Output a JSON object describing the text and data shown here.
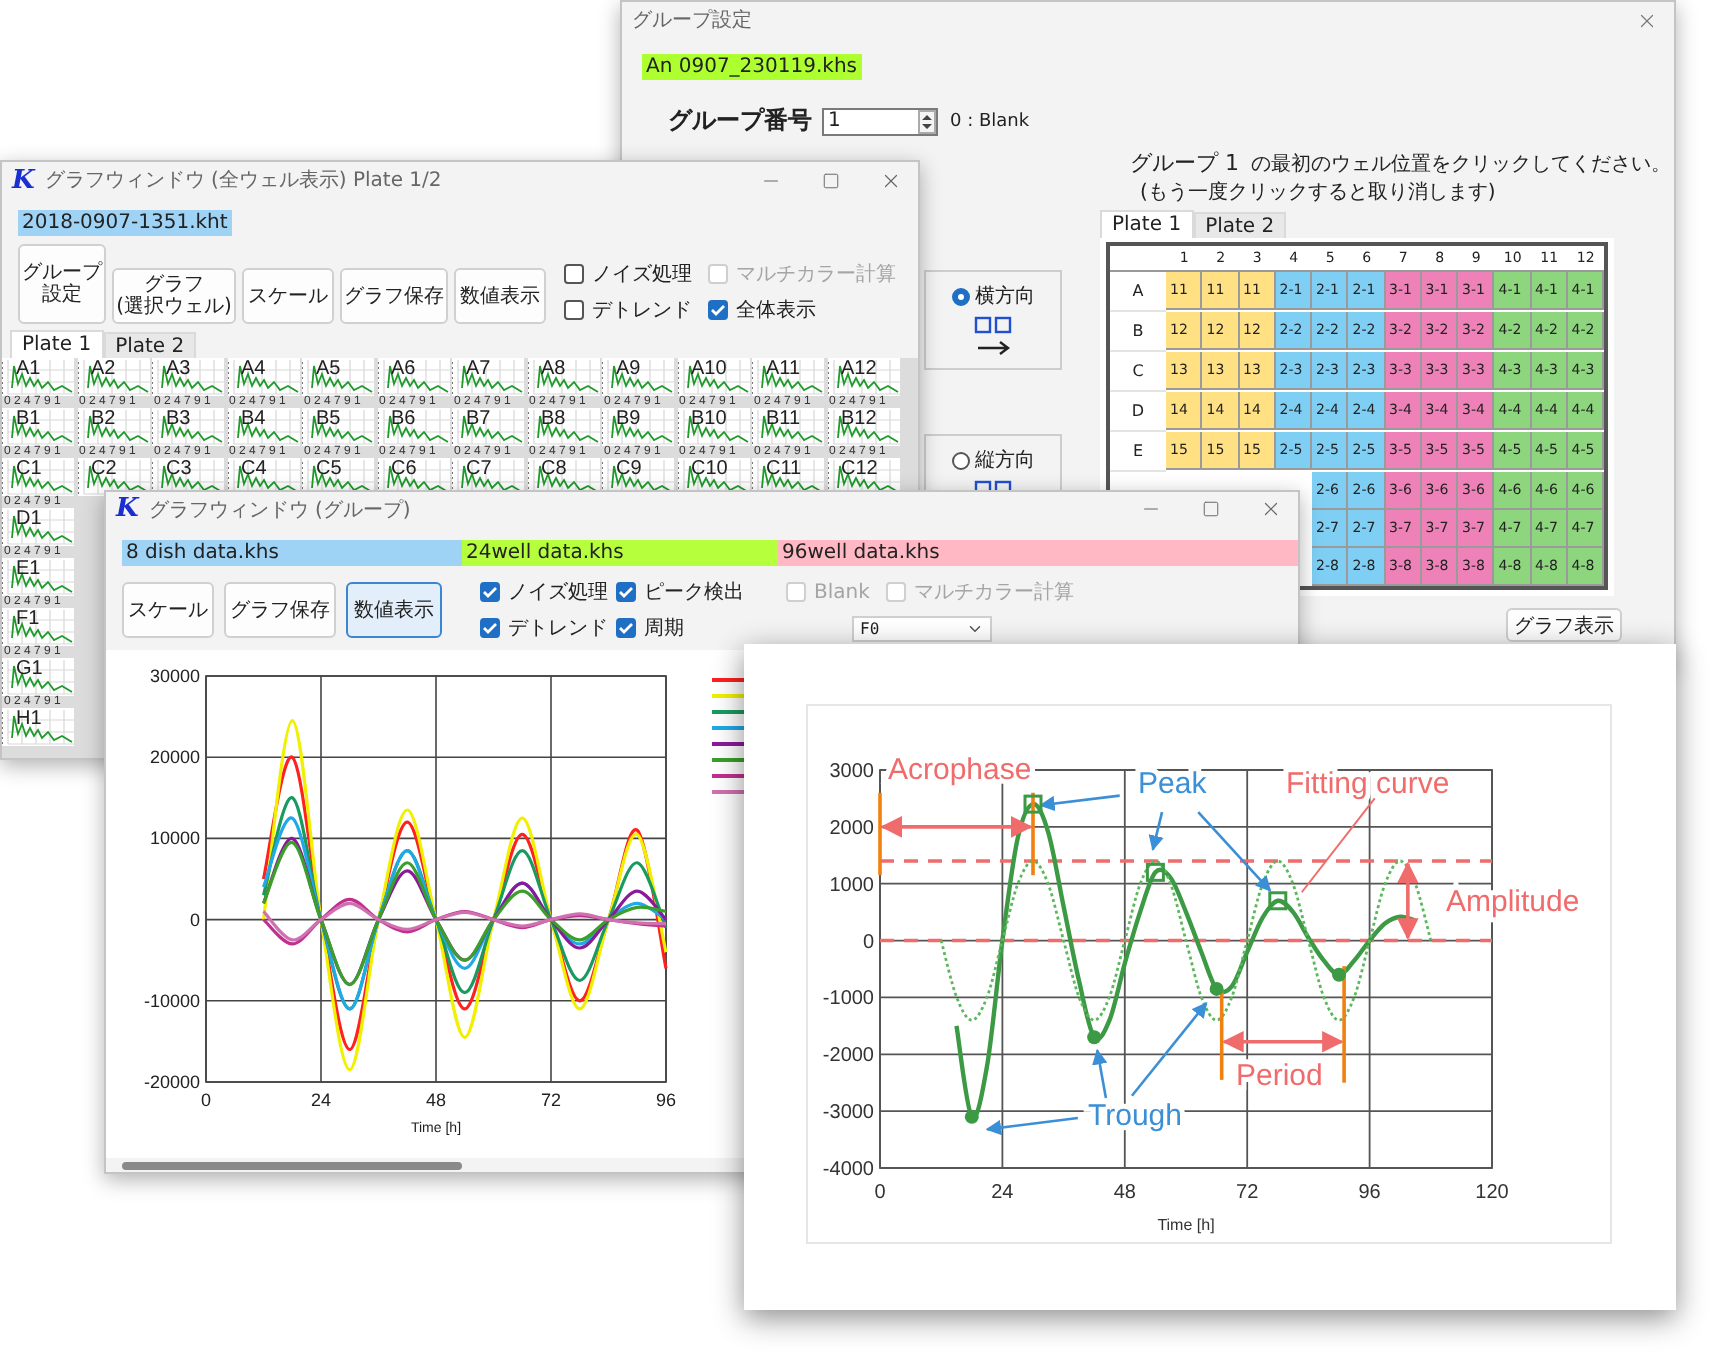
{
  "group_settings_window": {
    "title": "グループ設定",
    "file_label": {
      "text": "An 0907_230119.khs",
      "color": "#adff2f"
    },
    "group_number": {
      "label": "グループ番号",
      "value": "1",
      "hint": "0 : Blank"
    },
    "instruction": {
      "group": "グループ 1",
      "text": "の最初のウェル位置をクリックしてください。",
      "note": "(もう一度クリックすると取り消します)"
    },
    "direction_options": [
      {
        "label": "横方向",
        "selected": true
      },
      {
        "label": "縦方向",
        "selected": false
      }
    ],
    "tabs": [
      {
        "label": "Plate 1",
        "selected": true
      },
      {
        "label": "Plate 2",
        "selected": false
      }
    ],
    "plate": {
      "columns": [
        "1",
        "2",
        "3",
        "4",
        "5",
        "6",
        "7",
        "8",
        "9",
        "10",
        "11",
        "12"
      ],
      "rows": [
        {
          "label": "A",
          "cells": [
            {
              "text": "11",
              "color": "#ffe083"
            },
            {
              "text": "11",
              "color": "#ffe083"
            },
            {
              "text": "11",
              "color": "#ffe083"
            },
            {
              "text": "2-1",
              "color": "#7fcff5"
            },
            {
              "text": "2-1",
              "color": "#7fcff5"
            },
            {
              "text": "2-1",
              "color": "#7fcff5"
            },
            {
              "text": "3-1",
              "color": "#ee82b8"
            },
            {
              "text": "3-1",
              "color": "#ee82b8"
            },
            {
              "text": "3-1",
              "color": "#ee82b8"
            },
            {
              "text": "4-1",
              "color": "#8ed67e"
            },
            {
              "text": "4-1",
              "color": "#8ed67e"
            },
            {
              "text": "4-1",
              "color": "#8ed67e"
            }
          ]
        },
        {
          "label": "B",
          "cells": [
            {
              "text": "12",
              "color": "#ffe083"
            },
            {
              "text": "12",
              "color": "#ffe083"
            },
            {
              "text": "12",
              "color": "#ffe083"
            },
            {
              "text": "2-2",
              "color": "#7fcff5"
            },
            {
              "text": "2-2",
              "color": "#7fcff5"
            },
            {
              "text": "2-2",
              "color": "#7fcff5"
            },
            {
              "text": "3-2",
              "color": "#ee82b8"
            },
            {
              "text": "3-2",
              "color": "#ee82b8"
            },
            {
              "text": "3-2",
              "color": "#ee82b8"
            },
            {
              "text": "4-2",
              "color": "#8ed67e"
            },
            {
              "text": "4-2",
              "color": "#8ed67e"
            },
            {
              "text": "4-2",
              "color": "#8ed67e"
            }
          ]
        },
        {
          "label": "C",
          "cells": [
            {
              "text": "13",
              "color": "#ffe083"
            },
            {
              "text": "13",
              "color": "#ffe083"
            },
            {
              "text": "13",
              "color": "#ffe083"
            },
            {
              "text": "2-3",
              "color": "#7fcff5"
            },
            {
              "text": "2-3",
              "color": "#7fcff5"
            },
            {
              "text": "2-3",
              "color": "#7fcff5"
            },
            {
              "text": "3-3",
              "color": "#ee82b8"
            },
            {
              "text": "3-3",
              "color": "#ee82b8"
            },
            {
              "text": "3-3",
              "color": "#ee82b8"
            },
            {
              "text": "4-3",
              "color": "#8ed67e"
            },
            {
              "text": "4-3",
              "color": "#8ed67e"
            },
            {
              "text": "4-3",
              "color": "#8ed67e"
            }
          ]
        },
        {
          "label": "D",
          "cells": [
            {
              "text": "14",
              "color": "#ffe083"
            },
            {
              "text": "14",
              "color": "#ffe083"
            },
            {
              "text": "14",
              "color": "#ffe083"
            },
            {
              "text": "2-4",
              "color": "#7fcff5"
            },
            {
              "text": "2-4",
              "color": "#7fcff5"
            },
            {
              "text": "2-4",
              "color": "#7fcff5"
            },
            {
              "text": "3-4",
              "color": "#ee82b8"
            },
            {
              "text": "3-4",
              "color": "#ee82b8"
            },
            {
              "text": "3-4",
              "color": "#ee82b8"
            },
            {
              "text": "4-4",
              "color": "#8ed67e"
            },
            {
              "text": "4-4",
              "color": "#8ed67e"
            },
            {
              "text": "4-4",
              "color": "#8ed67e"
            }
          ]
        },
        {
          "label": "E",
          "cells": [
            {
              "text": "15",
              "color": "#ffe083"
            },
            {
              "text": "15",
              "color": "#ffe083"
            },
            {
              "text": "15",
              "color": "#ffe083"
            },
            {
              "text": "2-5",
              "color": "#7fcff5"
            },
            {
              "text": "2-5",
              "color": "#7fcff5"
            },
            {
              "text": "2-5",
              "color": "#7fcff5"
            },
            {
              "text": "3-5",
              "color": "#ee82b8"
            },
            {
              "text": "3-5",
              "color": "#ee82b8"
            },
            {
              "text": "3-5",
              "color": "#ee82b8"
            },
            {
              "text": "4-5",
              "color": "#8ed67e"
            },
            {
              "text": "4-5",
              "color": "#8ed67e"
            },
            {
              "text": "4-5",
              "color": "#8ed67e"
            }
          ]
        },
        {
          "cells": [
            {
              "text": "2-6",
              "color": "#7fcff5"
            },
            {
              "text": "2-6",
              "color": "#7fcff5"
            },
            {
              "text": "3-6",
              "color": "#ee82b8"
            },
            {
              "text": "3-6",
              "color": "#ee82b8"
            },
            {
              "text": "3-6",
              "color": "#ee82b8"
            },
            {
              "text": "4-6",
              "color": "#8ed67e"
            },
            {
              "text": "4-6",
              "color": "#8ed67e"
            },
            {
              "text": "4-6",
              "color": "#8ed67e"
            }
          ]
        },
        {
          "cells": [
            {
              "text": "2-7",
              "color": "#7fcff5"
            },
            {
              "text": "2-7",
              "color": "#7fcff5"
            },
            {
              "text": "3-7",
              "color": "#ee82b8"
            },
            {
              "text": "3-7",
              "color": "#ee82b8"
            },
            {
              "text": "3-7",
              "color": "#ee82b8"
            },
            {
              "text": "4-7",
              "color": "#8ed67e"
            },
            {
              "text": "4-7",
              "color": "#8ed67e"
            },
            {
              "text": "4-7",
              "color": "#8ed67e"
            }
          ]
        },
        {
          "cells": [
            {
              "text": "2-8",
              "color": "#7fcff5"
            },
            {
              "text": "2-8",
              "color": "#7fcff5"
            },
            {
              "text": "3-8",
              "color": "#ee82b8"
            },
            {
              "text": "3-8",
              "color": "#ee82b8"
            },
            {
              "text": "3-8",
              "color": "#ee82b8"
            },
            {
              "text": "4-8",
              "color": "#8ed67e"
            },
            {
              "text": "4-8",
              "color": "#8ed67e"
            },
            {
              "text": "4-8",
              "color": "#8ed67e"
            }
          ]
        }
      ]
    },
    "show_graph_button": "グラフ表示"
  },
  "all_wells_window": {
    "logo": "K",
    "title": "グラフウィンドウ (全ウェル表示) Plate 1/2",
    "file_label": {
      "text": "2018-0907-1351.kht",
      "color": "#9fd3f5"
    },
    "buttons": [
      {
        "lines": [
          "グループ",
          "設定"
        ]
      },
      {
        "lines": [
          "グラフ",
          "(選択ウェル)"
        ]
      },
      {
        "lines": [
          "スケール"
        ]
      },
      {
        "lines": [
          "グラフ保存"
        ]
      },
      {
        "lines": [
          "数値表示"
        ]
      }
    ],
    "options": [
      {
        "label": "ノイズ処理",
        "checked": false,
        "disabled": false
      },
      {
        "label": "マルチカラー計算",
        "checked": false,
        "disabled": true
      },
      {
        "label": "デトレンド",
        "checked": false,
        "disabled": false
      },
      {
        "label": "全体表示",
        "checked": true,
        "disabled": false
      }
    ],
    "tabs": [
      {
        "label": "Plate 1",
        "selected": true
      },
      {
        "label": "Plate 2",
        "selected": false
      }
    ],
    "well_rows": [
      {
        "wells": [
          {
            "label": "A1",
            "ticks": "0 2 4 7 9 1"
          },
          {
            "label": "A2",
            "ticks": "0 2 4 7 9 1"
          },
          {
            "label": "A3",
            "ticks": "0 2 4 7 9 1"
          },
          {
            "label": "A4",
            "ticks": "0 2 4 7 9 1"
          },
          {
            "label": "A5",
            "ticks": "0 2 4 7 9 1"
          },
          {
            "label": "A6",
            "ticks": "0 2 4 7 9 1"
          },
          {
            "label": "A7",
            "ticks": "0 2 4 7 9 1"
          },
          {
            "label": "A8",
            "ticks": "0 2 4 7 9 1"
          },
          {
            "label": "A9",
            "ticks": "0 2 4 7 9 1"
          },
          {
            "label": "A10",
            "ticks": "0 2 4 7 9 1"
          },
          {
            "label": "A11",
            "ticks": "0 2 4 7 9 1"
          },
          {
            "label": "A12",
            "ticks": "0 2 4 7 9 1"
          }
        ]
      },
      {
        "wells": [
          {
            "label": "B1",
            "ticks": "0 2 4 7 9 1"
          },
          {
            "label": "B2",
            "ticks": "0 2 4 7 9 1"
          },
          {
            "label": "B3",
            "ticks": "0 2 4 7 9 1"
          },
          {
            "label": "B4",
            "ticks": "0 2 4 7 9 1"
          },
          {
            "label": "B5",
            "ticks": "0 2 4 7 9 1"
          },
          {
            "label": "B6",
            "ticks": "0 2 4 7 9 1"
          },
          {
            "label": "B7",
            "ticks": "0 2 4 7 9 1"
          },
          {
            "label": "B8",
            "ticks": "0 2 4 7 9 1"
          },
          {
            "label": "B9",
            "ticks": "0 2 4 7 9 1"
          },
          {
            "label": "B10",
            "ticks": "0 2 4 7 9 1"
          },
          {
            "label": "B11",
            "ticks": "0 2 4 7 9 1"
          },
          {
            "label": "B12",
            "ticks": "0 2 4 7 9 1"
          }
        ]
      },
      {
        "wells": [
          {
            "label": "C1",
            "ticks": "0 2 4 7 9 1"
          },
          {
            "label": "C2"
          },
          {
            "label": "C3"
          },
          {
            "label": "C4"
          },
          {
            "label": "C5"
          },
          {
            "label": "C6"
          },
          {
            "label": "C7"
          },
          {
            "label": "C8"
          },
          {
            "label": "C9"
          },
          {
            "label": "C10"
          },
          {
            "label": "C11"
          },
          {
            "label": "C12"
          }
        ]
      },
      {
        "wells": [
          {
            "label": "D1",
            "ticks": "0 2 4 7 9 1"
          }
        ]
      },
      {
        "wells": [
          {
            "label": "E1",
            "ticks": "0 2 4 7 9 1"
          }
        ]
      },
      {
        "wells": [
          {
            "label": "F1",
            "ticks": "0 2 4 7 9 1"
          }
        ]
      },
      {
        "wells": [
          {
            "label": "G1",
            "ticks": "0 2 4 7 9 1"
          }
        ]
      },
      {
        "wells": [
          {
            "label": "H1"
          }
        ]
      }
    ]
  },
  "group_window": {
    "logo": "K",
    "title": "グラフウィンドウ (グループ)",
    "files": [
      {
        "label": "8 dish data.khs",
        "color": "#9fd3f5"
      },
      {
        "label": "24well data.khs",
        "color": "#b6ff3c"
      },
      {
        "label": "96well data.khs",
        "color": "#ffb8c4"
      }
    ],
    "buttons": [
      {
        "label": "スケール",
        "selected": false
      },
      {
        "label": "グラフ保存",
        "selected": false
      },
      {
        "label": "数値表示",
        "selected": true
      }
    ],
    "options": [
      {
        "label": "ノイズ処理",
        "checked": true,
        "disabled": false
      },
      {
        "label": "ピーク検出",
        "checked": true,
        "disabled": false
      },
      {
        "label": "デトレンド",
        "checked": true,
        "disabled": false
      },
      {
        "label": "周期",
        "checked": true,
        "disabled": false
      }
    ],
    "extra_options": [
      {
        "label": "Blank",
        "checked": false,
        "disabled": true
      },
      {
        "label": "マルチカラー計算",
        "checked": false,
        "disabled": true
      }
    ],
    "dropdown": {
      "value": "F0"
    },
    "chart_data": {
      "type": "line",
      "xlabel": "Time [h]",
      "x": [
        12,
        18,
        24,
        30,
        36,
        42,
        48,
        54,
        60,
        66,
        72,
        78,
        84,
        90,
        96
      ],
      "series": [
        {
          "color": "#ff2020",
          "values": [
            5000,
            20000,
            0,
            -16000,
            0,
            12000,
            0,
            -11000,
            0,
            10500,
            0,
            -10000,
            0,
            11000,
            -6000
          ]
        },
        {
          "color": "#f0f000",
          "values": [
            0,
            24500,
            0,
            -18500,
            0,
            13500,
            0,
            -14500,
            0,
            12500,
            0,
            -11000,
            0,
            10500,
            -4000
          ]
        },
        {
          "color": "#1a9a60",
          "values": [
            3000,
            15000,
            0,
            -11000,
            0,
            8500,
            0,
            -9000,
            0,
            8500,
            0,
            -7500,
            0,
            7000,
            -1000
          ]
        },
        {
          "color": "#20a8e8",
          "values": [
            4000,
            12500,
            0,
            -11000,
            0,
            8500,
            0,
            -6000,
            0,
            4500,
            0,
            -3000,
            0,
            2000,
            0
          ]
        },
        {
          "color": "#8a1a9a",
          "values": [
            2000,
            10000,
            0,
            -8000,
            0,
            6000,
            0,
            -5000,
            0,
            4500,
            0,
            -3500,
            0,
            3500,
            0
          ]
        },
        {
          "color": "#3aa02a",
          "values": [
            2000,
            9500,
            0,
            -8000,
            0,
            7000,
            0,
            -5000,
            0,
            3500,
            0,
            -2500,
            0,
            1500,
            1000
          ]
        },
        {
          "color": "#c0308f",
          "values": [
            0,
            -3000,
            0,
            2500,
            0,
            -1500,
            0,
            1000,
            0,
            -1000,
            0,
            500,
            0,
            -500,
            -800
          ]
        },
        {
          "color": "#d070b0",
          "values": [
            1000,
            -2500,
            0,
            2000,
            0,
            -1200,
            0,
            900,
            0,
            -800,
            0,
            700,
            0,
            -400,
            -500
          ]
        }
      ],
      "xlim": [
        0,
        96
      ],
      "ylim": [
        -20000,
        30000
      ],
      "xticks": [
        0,
        24,
        48,
        72,
        96
      ],
      "yticks": [
        -20000,
        -10000,
        0,
        10000,
        20000,
        30000
      ],
      "grid": true
    }
  },
  "annotated_figure": {
    "chart_data": {
      "type": "line",
      "xlabel": "Time [h]",
      "x": [
        12,
        15,
        18,
        21,
        24,
        27,
        30,
        33,
        36,
        39,
        42,
        45,
        48,
        51,
        54,
        57,
        60,
        63,
        66,
        69,
        72,
        75,
        78,
        81,
        84,
        87,
        90,
        93,
        96,
        99,
        102,
        105,
        108
      ],
      "series": [
        {
          "color": "#3c9a45",
          "values": [
            null,
            -1500,
            -3100,
            -2200,
            0,
            1800,
            2400,
            1900,
            600,
            -700,
            -1700,
            -1400,
            -400,
            500,
            1200,
            1100,
            500,
            -200,
            -850,
            -800,
            -200,
            400,
            700,
            500,
            50,
            -350,
            -600,
            -350,
            0,
            300,
            420,
            350,
            null
          ]
        },
        {
          "color": "#5cb85c",
          "line_style": "dotted",
          "values": [
            0,
            -990,
            -1400,
            -990,
            0,
            990,
            1400,
            990,
            0,
            -990,
            -1400,
            -990,
            0,
            990,
            1400,
            990,
            0,
            -990,
            -1400,
            -990,
            0,
            990,
            1400,
            990,
            0,
            -990,
            -1400,
            -990,
            0,
            990,
            1400,
            990,
            0
          ]
        }
      ],
      "xlim": [
        0,
        120
      ],
      "ylim": [
        -4000,
        3000
      ],
      "xticks": [
        0,
        24,
        48,
        72,
        96,
        120
      ],
      "yticks": [
        -4000,
        -3000,
        -2000,
        -1000,
        0,
        1000,
        2000,
        3000
      ],
      "grid": true,
      "ref_lines": [
        {
          "axis": "y",
          "value": 1400
        },
        {
          "axis": "y",
          "value": 0
        }
      ],
      "annotations": [
        "Acrophase",
        "Peak",
        "Fitting curve",
        "Amplitude",
        "Period",
        "Trough"
      ]
    }
  }
}
